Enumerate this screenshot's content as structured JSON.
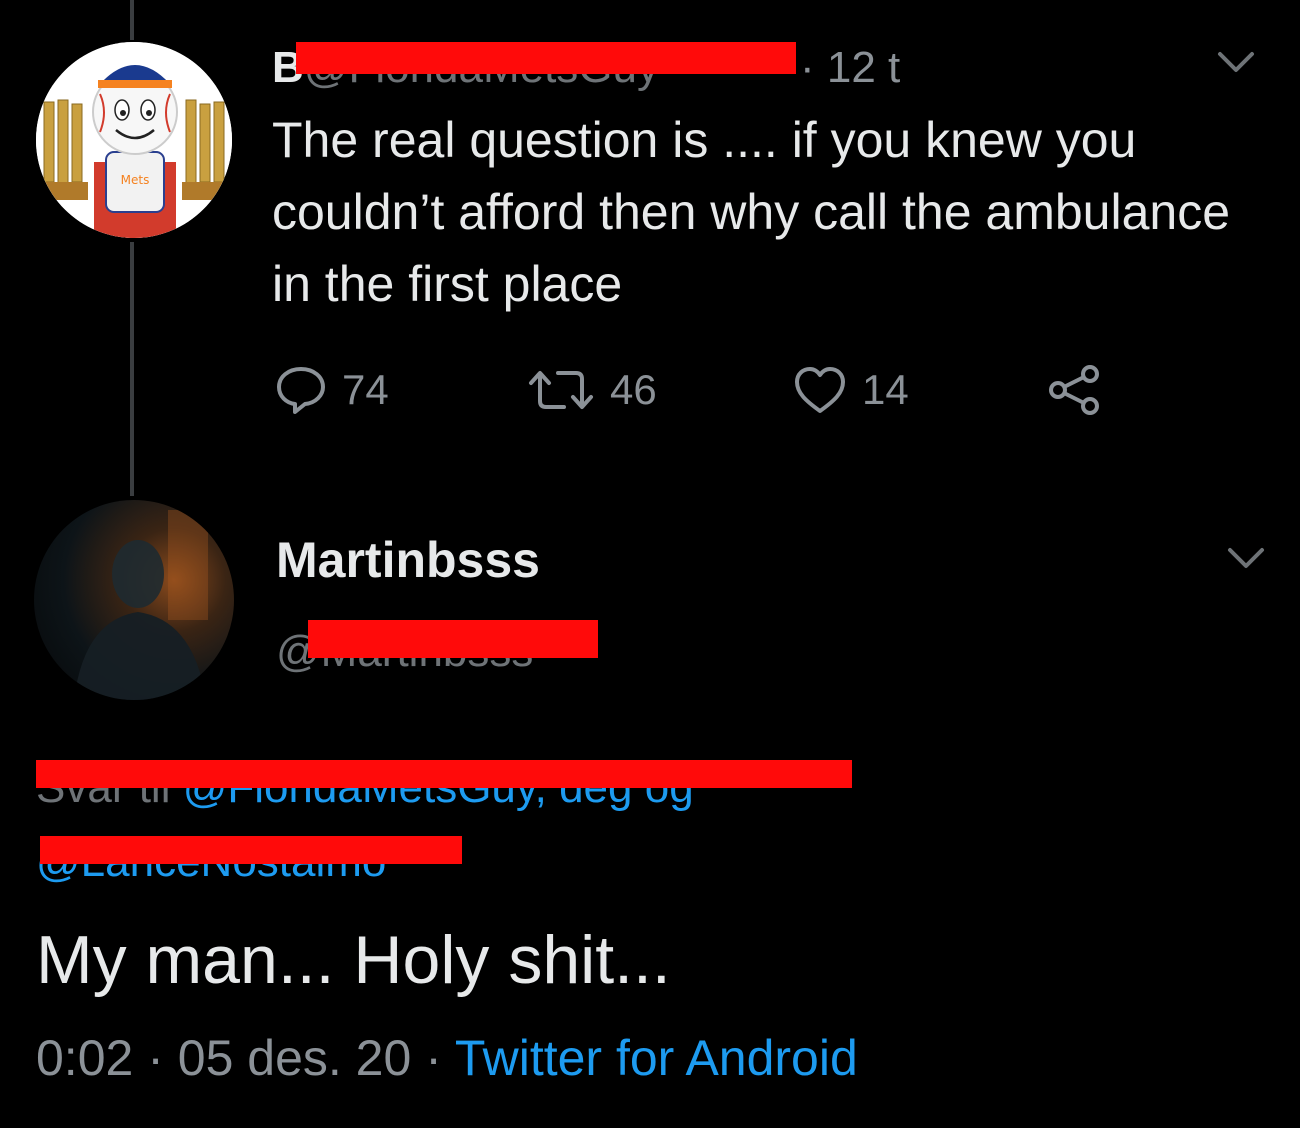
{
  "tweet": {
    "author_initial": "B",
    "handle": "@FloridaMetsGuy",
    "time": "· 12 t",
    "text": "The real question is .... if you knew you couldn’t afford then why call the ambulance in the first place",
    "reply_count": "74",
    "retweet_count": "46",
    "like_count": "14"
  },
  "reply": {
    "name": "Martinbsss",
    "handle": "@Martinbsss",
    "replying_prefix": "Svar til ",
    "replying_to_1": "@FloridaMetsGuy",
    "replying_joiner": ", deg og",
    "replying_to_2": "@LanceNostalmo",
    "text": "My man... Holy shit...",
    "time": "0:02",
    "sep1": " · ",
    "date": "05 des. 20",
    "sep2": " · ",
    "source": "Twitter for Android"
  },
  "icons": {
    "reply": "reply-bubble-icon",
    "retweet": "retweet-icon",
    "like": "heart-icon",
    "share": "share-icon",
    "menu": "chevron-down-icon"
  },
  "colors": {
    "background": "#000000",
    "text": "#e7e9ea",
    "muted": "#8b9197",
    "link": "#1d9bf0",
    "redaction": "#ff0a0a"
  }
}
